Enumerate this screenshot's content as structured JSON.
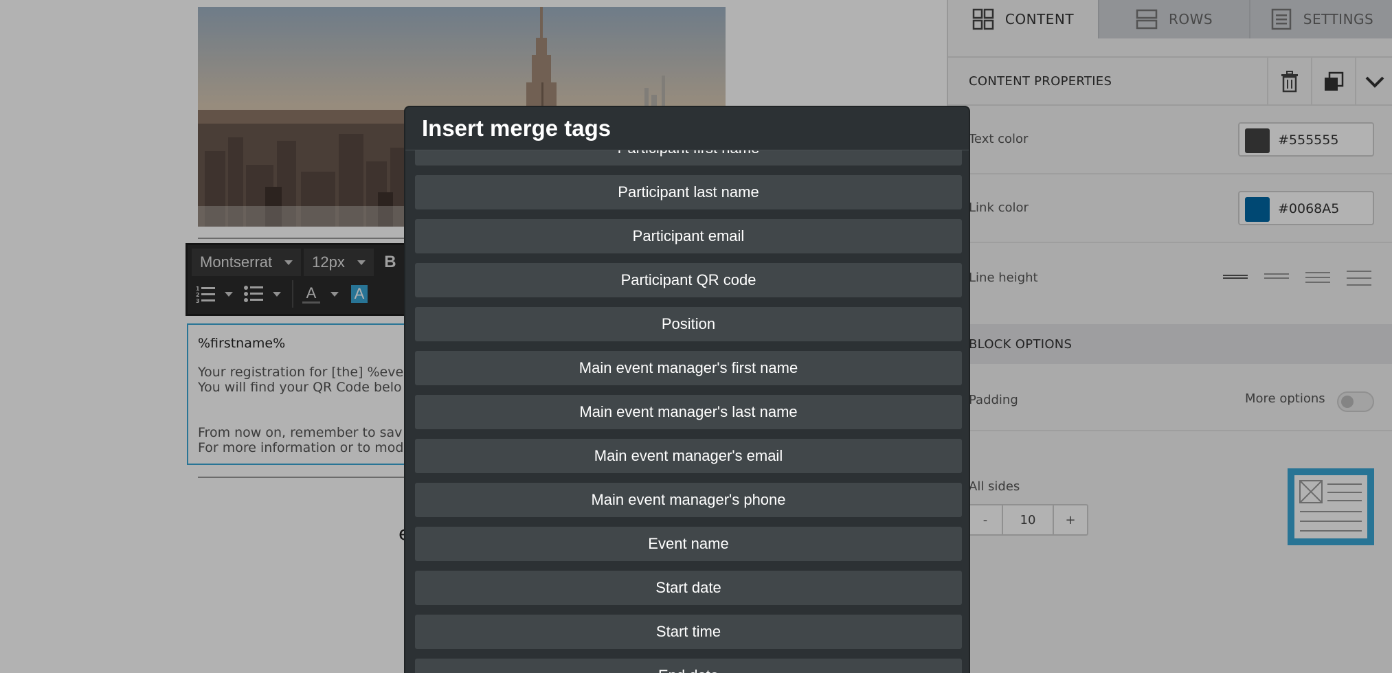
{
  "editor": {
    "toolbar": {
      "font": "Montserrat",
      "size": "12px",
      "bold": "B",
      "font_color_glyph": "A",
      "highlight_glyph": "A"
    },
    "text_block": {
      "lines": [
        "%firstname%",
        "Your registration for [the] %ever",
        "You will find your QR Code belo",
        "From now on, remember to sav",
        "For more information or to mod"
      ]
    },
    "below_glyph": "e"
  },
  "panel": {
    "tabs": [
      {
        "label": "CONTENT",
        "icon": "grid-icon"
      },
      {
        "label": "ROWS",
        "icon": "rows-icon"
      },
      {
        "label": "SETTINGS",
        "icon": "settings-icon"
      }
    ],
    "content_properties": "CONTENT PROPERTIES",
    "text_color": {
      "label": "Text color",
      "value": "#555555"
    },
    "link_color": {
      "label": "Link color",
      "value": "#0068A5"
    },
    "line_height": {
      "label": "Line height"
    },
    "block_options": "BLOCK OPTIONS",
    "padding": {
      "label": "Padding",
      "more_options": "More options",
      "more_options_on": false
    },
    "all_sides": {
      "label": "All sides",
      "minus": "-",
      "value": "10",
      "plus": "+"
    }
  },
  "modal": {
    "title": "Insert merge tags",
    "tags": [
      "Participant first name",
      "Participant last name",
      "Participant email",
      "Participant QR code",
      "Position",
      "Main event manager's first name",
      "Main event manager's last name",
      "Main event manager's email",
      "Main event manager's phone",
      "Event name",
      "Start date",
      "Start time",
      "End date"
    ]
  },
  "colors": {
    "accent": "#3aa7d6",
    "modal_bg": "#2c3134",
    "tag_bg": "#41474a",
    "text_color_swatch": "#444444",
    "link_color_swatch": "#0068A5"
  }
}
